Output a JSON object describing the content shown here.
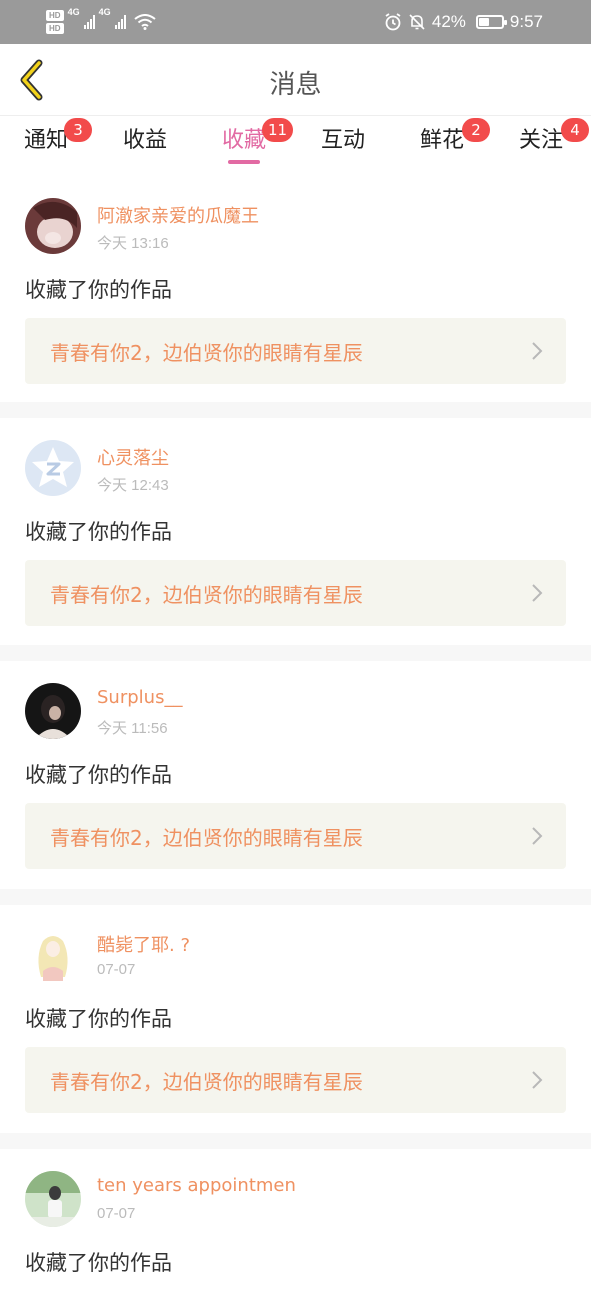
{
  "status_bar": {
    "hd1": "HD",
    "hd2": "HD",
    "net1": "4G",
    "net2": "4G",
    "battery_percent": "42%",
    "battery_level": 0.42,
    "time": "9:57",
    "icons": [
      "alarm-icon",
      "mute-icon",
      "wifi-icon",
      "signal-icon",
      "battery-icon"
    ]
  },
  "header": {
    "title": "消息",
    "back_icon": "chevron-left-icon",
    "accent": "#e6b800"
  },
  "tabs": [
    {
      "label": "通知",
      "badge": "3",
      "active": false
    },
    {
      "label": "收益",
      "badge": "",
      "active": false
    },
    {
      "label": "收藏",
      "badge": "11",
      "active": true
    },
    {
      "label": "互动",
      "badge": "",
      "active": false
    },
    {
      "label": "鲜花",
      "badge": "2",
      "active": false
    },
    {
      "label": "关注",
      "badge": "4",
      "active": false
    }
  ],
  "colors": {
    "active_tab": "#e26aa3",
    "badge": "#f24b4b",
    "username": "#ef9161",
    "work_title": "#ef9161",
    "work_bg": "#f5f5ee"
  },
  "feed": [
    {
      "username": "阿澈家亲爱的瓜魔王",
      "time": "今天 13:16",
      "action": "收藏了你的作品",
      "work": "青春有你2，边伯贤你的眼睛有星辰",
      "avatar": "avatar-photo-girl"
    },
    {
      "username": "心灵落尘",
      "time": "今天 12:43",
      "action": "收藏了你的作品",
      "work": "青春有你2，边伯贤你的眼睛有星辰",
      "avatar": "avatar-default-star"
    },
    {
      "username": "Surplus__",
      "time": "今天 11:56",
      "action": "收藏了你的作品",
      "work": "青春有你2，边伯贤你的眼睛有星辰",
      "avatar": "avatar-photo-dark"
    },
    {
      "username": "酷毙了耶. ?",
      "time": "07-07",
      "action": "收藏了你的作品",
      "work": "青春有你2，边伯贤你的眼睛有星辰",
      "avatar": "avatar-illustration-girl"
    },
    {
      "username": "ten years appointmen",
      "time": "07-07",
      "action": "收藏了你的作品",
      "work": "",
      "avatar": "avatar-photo-outdoor"
    }
  ]
}
